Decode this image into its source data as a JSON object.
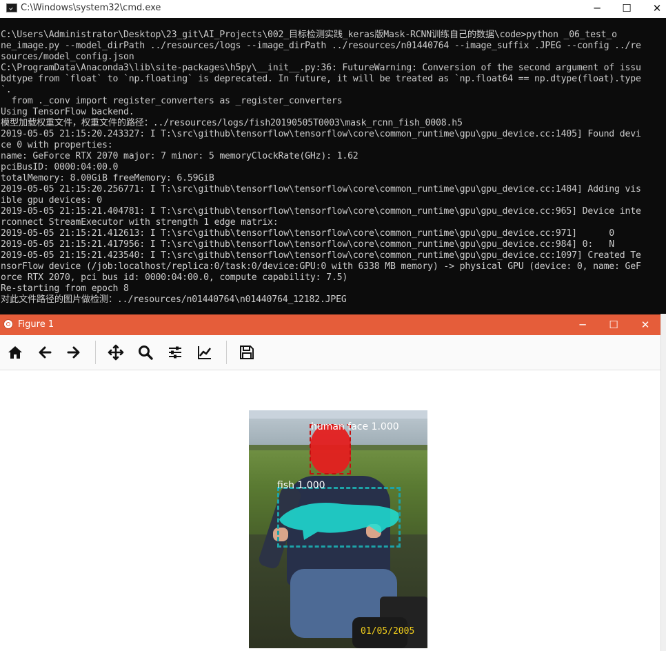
{
  "cmd": {
    "title": "C:\\Windows\\system32\\cmd.exe",
    "lines": [
      "C:\\Users\\Administrator\\Desktop\\23_git\\AI_Projects\\002_目标检测实践_keras版Mask-RCNN训练自己的数据\\code>python _06_test_o",
      "ne_image.py --model_dirPath ../resources/logs --image_dirPath ../resources/n01440764 --image_suffix .JPEG --config ../re",
      "sources/model_config.json",
      "C:\\ProgramData\\Anaconda3\\lib\\site-packages\\h5py\\__init__.py:36: FutureWarning: Conversion of the second argument of issu",
      "bdtype from `float` to `np.floating` is deprecated. In future, it will be treated as `np.float64 == np.dtype(float).type",
      "`.",
      "  from ._conv import register_converters as _register_converters",
      "Using TensorFlow backend.",
      "模型加载权重文件，权重文件的路径：../resources/logs/fish20190505T0003\\mask_rcnn_fish_0008.h5",
      "2019-05-05 21:15:20.243327: I T:\\src\\github\\tensorflow\\tensorflow\\core\\common_runtime\\gpu\\gpu_device.cc:1405] Found devi",
      "ce 0 with properties:",
      "name: GeForce RTX 2070 major: 7 minor: 5 memoryClockRate(GHz): 1.62",
      "pciBusID: 0000:04:00.0",
      "totalMemory: 8.00GiB freeMemory: 6.59GiB",
      "2019-05-05 21:15:20.256771: I T:\\src\\github\\tensorflow\\tensorflow\\core\\common_runtime\\gpu\\gpu_device.cc:1484] Adding vis",
      "ible gpu devices: 0",
      "2019-05-05 21:15:21.404781: I T:\\src\\github\\tensorflow\\tensorflow\\core\\common_runtime\\gpu\\gpu_device.cc:965] Device inte",
      "rconnect StreamExecutor with strength 1 edge matrix:",
      "2019-05-05 21:15:21.412613: I T:\\src\\github\\tensorflow\\tensorflow\\core\\common_runtime\\gpu\\gpu_device.cc:971]      0",
      "2019-05-05 21:15:21.417956: I T:\\src\\github\\tensorflow\\tensorflow\\core\\common_runtime\\gpu\\gpu_device.cc:984] 0:   N",
      "2019-05-05 21:15:21.423540: I T:\\src\\github\\tensorflow\\tensorflow\\core\\common_runtime\\gpu\\gpu_device.cc:1097] Created Te",
      "nsorFlow device (/job:localhost/replica:0/task:0/device:GPU:0 with 6338 MB memory) -> physical GPU (device: 0, name: GeF",
      "orce RTX 2070, pci bus id: 0000:04:00.0, compute capability: 7.5)",
      "Re-starting from epoch 8",
      "对此文件路径的图片做检测：../resources/n01440764\\n01440764_12182.JPEG"
    ],
    "buttons": {
      "minimize": "─",
      "maximize": "☐",
      "close": "✕"
    }
  },
  "figure": {
    "title": "Figure 1",
    "buttons": {
      "minimize": "─",
      "maximize": "☐",
      "close": "✕"
    },
    "toolbar": [
      {
        "name": "home-icon",
        "tool": "home"
      },
      {
        "name": "back-icon",
        "tool": "back"
      },
      {
        "name": "forward-icon",
        "tool": "forward"
      },
      {
        "name": "pan-icon",
        "tool": "pan"
      },
      {
        "name": "zoom-icon",
        "tool": "zoom"
      },
      {
        "name": "configure-subplots-icon",
        "tool": "subplots"
      },
      {
        "name": "edit-axis-icon",
        "tool": "edit"
      },
      {
        "name": "save-icon",
        "tool": "save"
      }
    ],
    "detections": [
      {
        "label": "human face 1.000",
        "color": "#e41f1f"
      },
      {
        "label": "fish 1.000",
        "color": "#1fd6d0"
      }
    ],
    "date_stamp": "01/05/2005"
  },
  "colors": {
    "figure_titlebar": "#e55d3a",
    "console_bg": "#0c0c0c",
    "console_text": "#cccccc"
  }
}
